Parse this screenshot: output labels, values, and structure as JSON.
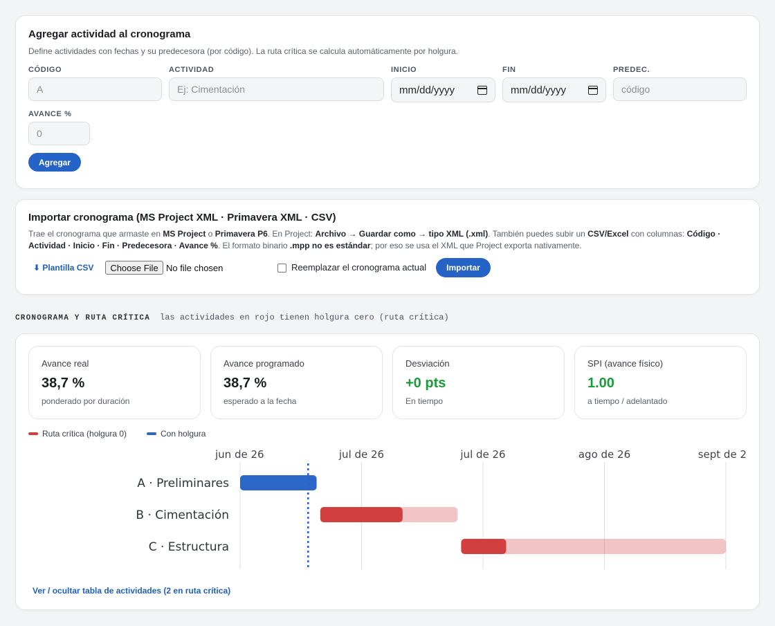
{
  "add_form": {
    "title": "Agregar actividad al cronograma",
    "description": "Define actividades con fechas y su predecesora (por código). La ruta crítica se calcula automáticamente por holgura.",
    "fields": {
      "code": {
        "label": "CÓDIGO",
        "placeholder": "A"
      },
      "activity": {
        "label": "ACTIVIDAD",
        "placeholder": "Ej: Cimentación"
      },
      "start": {
        "label": "INICIO",
        "value": "mm/dd/yyyy"
      },
      "end": {
        "label": "FIN",
        "value": "mm/dd/yyyy"
      },
      "pred": {
        "label": "PREDEC.",
        "placeholder": "código"
      },
      "progress": {
        "label": "AVANCE %",
        "placeholder": "0"
      }
    },
    "submit_label": "Agregar"
  },
  "import": {
    "title": "Importar cronograma (MS Project XML · Primavera XML · CSV)",
    "desc": {
      "p1": "Trae el cronograma que armaste en ",
      "b1": "MS Project",
      "p2": " o ",
      "b2": "Primavera P6",
      "p3": ". En Project: ",
      "b3": "Archivo → Guardar como → tipo XML (.xml)",
      "p4": ". También puedes subir un ",
      "b4": "CSV/Excel",
      "p5": " con columnas: ",
      "b5": "Código · Actividad · Inicio · Fin · Predecesora · Avance %",
      "p6": ". El formato binario ",
      "b6": ".mpp no es estándar",
      "p7": "; por eso se usa el XML que Project exporta nativamente."
    },
    "template_link": "⬇ Plantilla CSV",
    "file_button": "Choose File",
    "file_status": "No file chosen",
    "replace_label": "Reemplazar el cronograma actual",
    "import_button": "Importar"
  },
  "section": {
    "title": "CRONOGRAMA Y RUTA CRÍTICA",
    "subtitle": "las actividades en rojo tienen holgura cero (ruta crítica)"
  },
  "kpis": [
    {
      "label": "Avance real",
      "value": "38,7 %",
      "sub": "ponderado por duración"
    },
    {
      "label": "Avance programado",
      "value": "38,7 %",
      "sub": "esperado a la fecha"
    },
    {
      "label": "Desviación",
      "value": "+0 pts",
      "sub": "En tiempo",
      "color": "#1a9c3a"
    },
    {
      "label": "SPI (avance físico)",
      "value": "1.00",
      "sub": "a tiempo / adelantado",
      "color": "#1a9c3a"
    }
  ],
  "legend": {
    "critical": {
      "label": "Ruta crítica (holgura 0)",
      "color": "#d13f3f"
    },
    "slack": {
      "label": "Con holgura",
      "color": "#2b67c6"
    }
  },
  "chart_data": {
    "type": "gantt",
    "x_ticks": [
      "jun de 26",
      "jul de 26",
      "jul de 26",
      "ago de 26",
      "sept de 2"
    ],
    "today_marker": 0.56,
    "tasks": [
      {
        "label": "A · Preliminares",
        "start": 0.0,
        "end": 0.63,
        "progress": 1.0,
        "critical": false
      },
      {
        "label": "B · Cimentación",
        "start": 0.66,
        "end": 1.79,
        "progress": 0.6,
        "critical": true
      },
      {
        "label": "C · Estructura",
        "start": 1.82,
        "end": 4.0,
        "progress": 0.17,
        "critical": true
      }
    ]
  },
  "toggle_link": "Ver / ocultar tabla de actividades (2 en ruta crítica)"
}
